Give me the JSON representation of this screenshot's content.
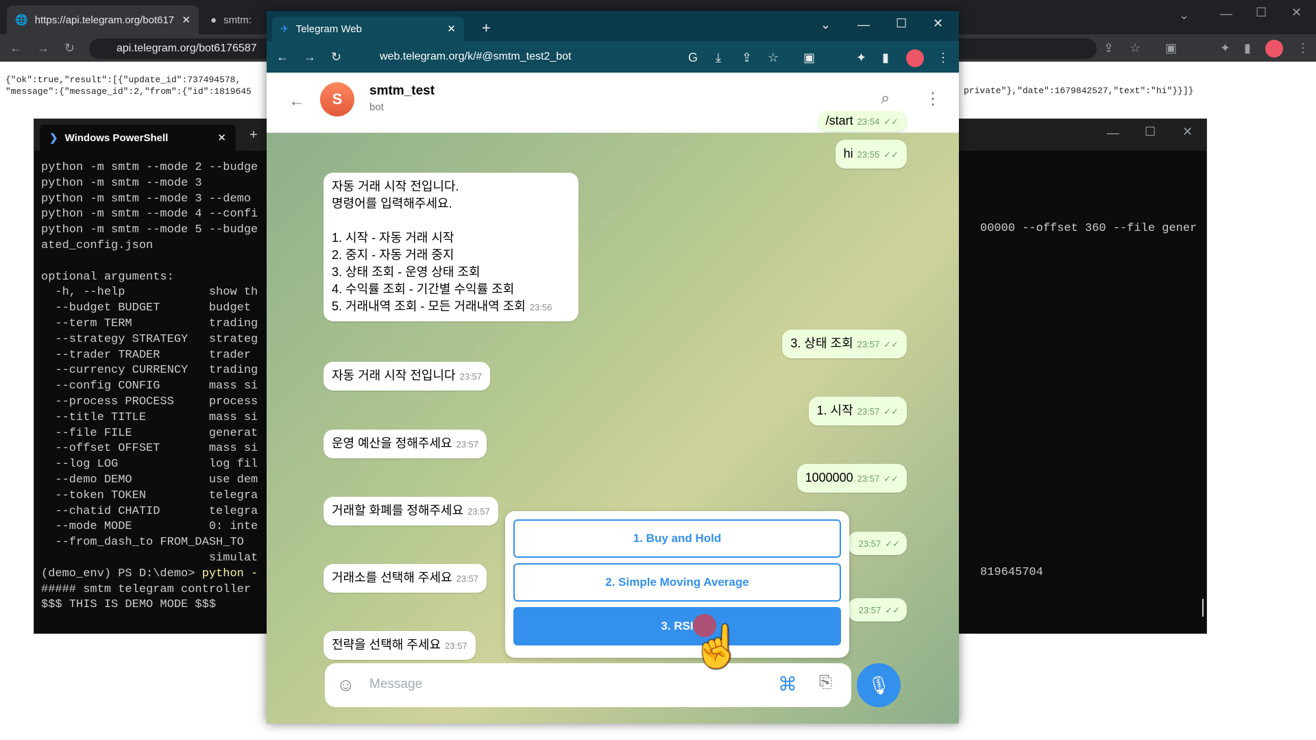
{
  "bg_browser": {
    "tab1_title": "https://api.telegram.org/bot617",
    "tab2_title": "smtm:",
    "url": "api.telegram.org/bot6176587",
    "json_line1": "{\"ok\":true,\"result\":[{\"update_id\":737494578,",
    "json_line2": "\"message\":{\"message_id\":2,\"from\":{\"id\":1819645",
    "json_right": "private\"},\"date\":1679842527,\"text\":\"hi\"}}]}"
  },
  "powershell": {
    "tab_title": "Windows PowerShell",
    "lines": "python -m smtm --mode 2 --budge\npython -m smtm --mode 3\npython -m smtm --mode 3 --demo\npython -m smtm --mode 4 --confi\npython -m smtm --mode 5 --budge\nated_config.json\n\noptional arguments:\n  -h, --help            show th\n  --budget BUDGET       budget\n  --term TERM           trading\n  --strategy STRATEGY   strateg\n  --trader TRADER       trader\n  --currency CURRENCY   trading\n  --config CONFIG       mass si\n  --process PROCESS     process\n  --title TITLE         mass si\n  --file FILE           generat\n  --offset OFFSET       mass si\n  --log LOG             log fil\n  --demo DEMO           use dem\n  --token TOKEN         telegra\n  --chatid CHATID       telegra\n  --mode MODE           0: inte\n  --from_dash_to FROM_DASH_TO\n                        simulat",
    "prompt": "(demo_env) PS D:\\demo> ",
    "prompt_cmd": "python -",
    "line_ctrl": "##### smtm telegram controller",
    "line_demo": "$$$ THIS IS DEMO MODE $$$",
    "right_text1": "00000 --offset 360 --file gener",
    "right_text2": "819645704"
  },
  "telegram": {
    "tab_title": "Telegram Web",
    "url": "web.telegram.org/k/#@smtm_test2_bot",
    "chat_name": "smtm_test",
    "chat_status": "bot",
    "avatar_letter": "S",
    "messages": {
      "start": {
        "text": "/start",
        "time": "23:54"
      },
      "hi": {
        "text": "hi",
        "time": "23:55"
      },
      "menu": {
        "text": "자동 거래 시작 전입니다.\n명령어를 입력해주세요.\n\n1. 시작 - 자동 거래 시작\n2. 중지 - 자동 거래 중지\n3. 상태 조회 - 운영 상태 조회\n4. 수익률 조회 - 기간별 수익률 조회\n5. 거래내역 조회 - 모든 거래내역 조회",
        "time": "23:56"
      },
      "status": {
        "text": "3. 상태 조회",
        "time": "23:57"
      },
      "notstarted": {
        "text": "자동 거래 시작 전입니다",
        "time": "23:57"
      },
      "start1": {
        "text": "1. 시작",
        "time": "23:57"
      },
      "budget_q": {
        "text": "운영 예산을 정해주세요",
        "time": "23:57"
      },
      "budget": {
        "text": "1000000",
        "time": "23:57"
      },
      "currency_q": {
        "text": "거래할 화폐를 정해주세요",
        "time": "23:57"
      },
      "out6_time": "23:57",
      "exchange_q": {
        "text": "거래소를 선택해 주세요",
        "time": "23:57"
      },
      "out7_time": "23:57",
      "strategy_q": {
        "text": "전략을 선택해 주세요",
        "time": "23:57"
      }
    },
    "keyboard": [
      "1. Buy and Hold",
      "2. Simple Moving Average",
      "3. RSI"
    ],
    "composer_placeholder": "Message",
    "accent": "#3390ec"
  }
}
